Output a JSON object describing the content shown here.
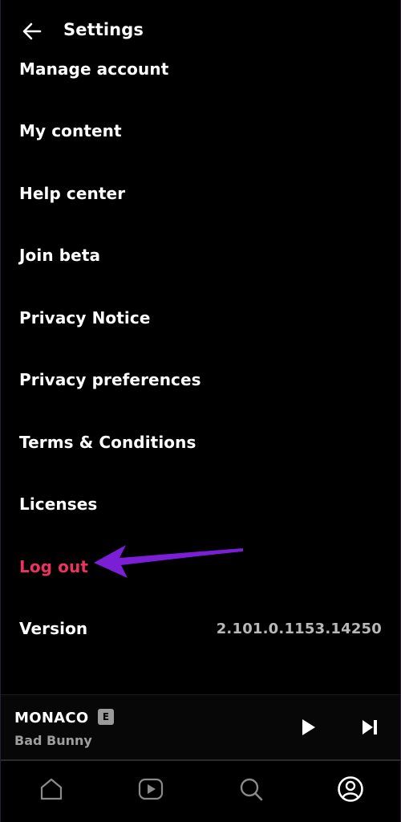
{
  "header": {
    "title": "Settings",
    "back_icon": "arrow-left-icon"
  },
  "menu": {
    "items": [
      {
        "label": "Manage account"
      },
      {
        "label": "My content"
      },
      {
        "label": "Help center"
      },
      {
        "label": "Join beta"
      },
      {
        "label": "Privacy Notice"
      },
      {
        "label": "Privacy preferences"
      },
      {
        "label": "Terms & Conditions"
      },
      {
        "label": "Licenses"
      },
      {
        "label": "Log out"
      },
      {
        "label": "Version",
        "value": "2.101.0.1153.14250"
      }
    ]
  },
  "player": {
    "title": "MONACO",
    "explicit_badge": "E",
    "artist": "Bad Bunny",
    "play_icon": "play-icon",
    "next_icon": "skip-next-icon"
  },
  "nav": {
    "items": [
      {
        "icon": "home-icon"
      },
      {
        "icon": "video-play-icon"
      },
      {
        "icon": "search-icon"
      },
      {
        "icon": "profile-icon",
        "active": true
      }
    ]
  },
  "colors": {
    "background": "#000000",
    "text": "#ffffff",
    "danger": "#e8345f",
    "annotation_arrow": "#7a1fd6",
    "secondary_text": "#9e9e9e"
  }
}
